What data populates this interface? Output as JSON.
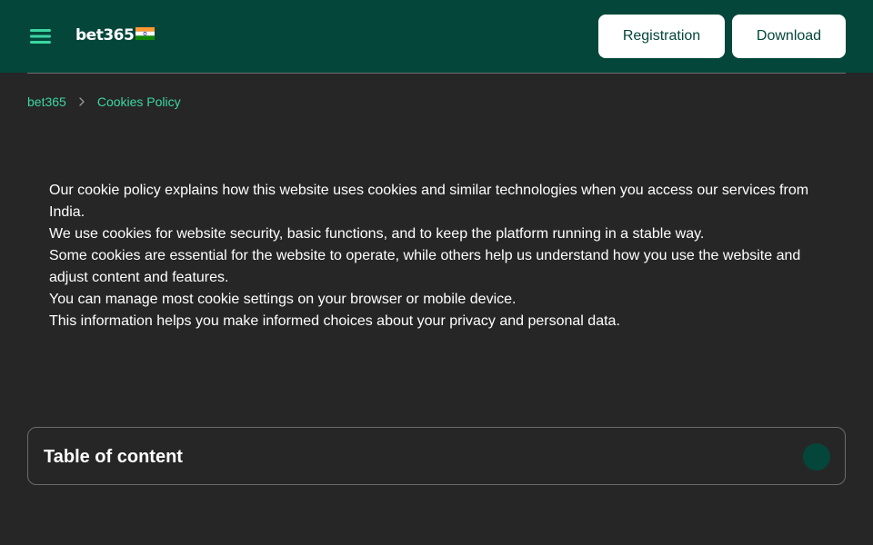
{
  "header": {
    "logo_text": "bet365",
    "registration_label": "Registration",
    "download_label": "Download"
  },
  "breadcrumb": {
    "home": "bet365",
    "current": "Cookies Policy"
  },
  "content": {
    "paragraphs": [
      "Our cookie policy explains how this website uses cookies and similar technologies when you access our services from India.",
      "We use cookies for website security, basic functions, and to keep the platform running in a stable way.",
      "Some cookies are essential for the website to operate, while others help us understand how you use the website and adjust content and features.",
      "You can manage most cookie settings on your browser or mobile device.",
      "This information helps you make informed choices about your privacy and personal data."
    ]
  },
  "toc": {
    "title": "Table of content"
  },
  "icons": {
    "menu": "hamburger-menu-icon",
    "flag": "india-flag-icon",
    "separator": "chevron-right-icon"
  },
  "colors": {
    "header_bg": "#04473a",
    "page_bg": "#262626",
    "accent_link": "#3cd6a2",
    "button_bg": "#ffffff",
    "button_text": "#04473a"
  }
}
